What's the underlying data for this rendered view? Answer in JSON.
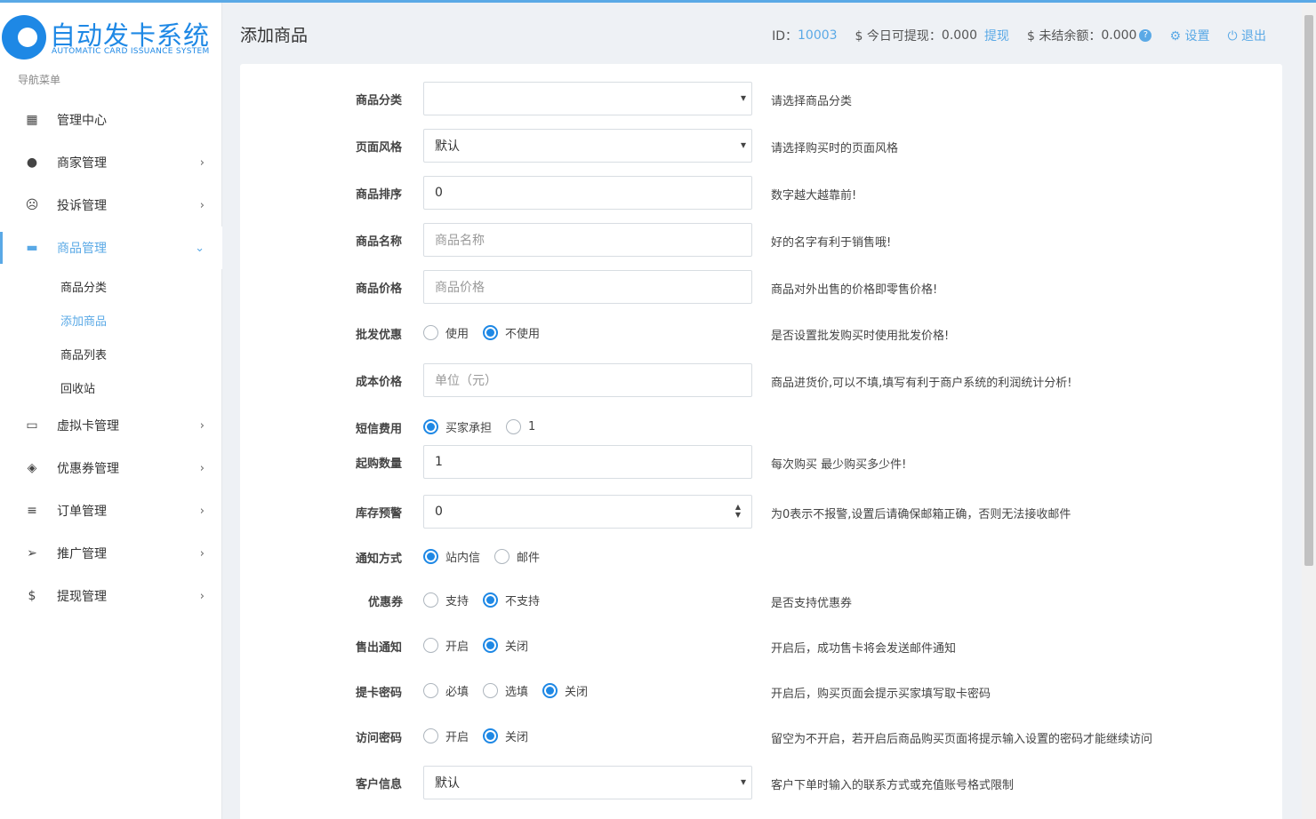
{
  "logo": {
    "title": "自动发卡系统",
    "subtitle": "AUTOMATIC CARD ISSUANCE SYSTEM"
  },
  "sidebar": {
    "caption": "导航菜单",
    "items": [
      {
        "label": "管理中心",
        "icon": "dashboard-icon",
        "glyph": "▦",
        "chev": ""
      },
      {
        "label": "商家管理",
        "icon": "user-icon",
        "glyph": "●",
        "chev": "›"
      },
      {
        "label": "投诉管理",
        "icon": "frown-icon",
        "glyph": "☹",
        "chev": "›"
      },
      {
        "label": "商品管理",
        "icon": "shopping-bag-icon",
        "glyph": "▬",
        "chev": "⌄"
      },
      {
        "label": "虚拟卡管理",
        "icon": "card-icon",
        "glyph": "▭",
        "chev": "›"
      },
      {
        "label": "优惠券管理",
        "icon": "ticket-icon",
        "glyph": "◈",
        "chev": "›"
      },
      {
        "label": "订单管理",
        "icon": "list-icon",
        "glyph": "≡",
        "chev": "›"
      },
      {
        "label": "推广管理",
        "icon": "paper-plane-icon",
        "glyph": "➢",
        "chev": "›"
      },
      {
        "label": "提现管理",
        "icon": "dollar-icon",
        "glyph": "$",
        "chev": "›"
      }
    ],
    "sub_items": [
      "商品分类",
      "添加商品",
      "商品列表",
      "回收站"
    ]
  },
  "header": {
    "page_title": "添加商品",
    "id_label": "ID：",
    "id_value": "10003",
    "withdrawable_label": "$ 今日可提现：",
    "withdrawable_value": "0.000",
    "withdraw_link": "提现",
    "unsettled_label": "$ 未结余额：",
    "unsettled_value": "0.000",
    "help_badge": "?",
    "settings_label": "设置",
    "logout_label": "退出"
  },
  "form": {
    "category": {
      "label": "商品分类",
      "value": "",
      "help": "请选择商品分类"
    },
    "page_style": {
      "label": "页面风格",
      "value": "默认",
      "help": "请选择购买时的页面风格"
    },
    "sort": {
      "label": "商品排序",
      "value": "0",
      "help": "数字越大越靠前!"
    },
    "name": {
      "label": "商品名称",
      "placeholder": "商品名称",
      "help": "好的名字有利于销售哦!"
    },
    "price": {
      "label": "商品价格",
      "placeholder": "商品价格",
      "help": "商品对外出售的价格即零售价格!"
    },
    "wholesale": {
      "label": "批发优惠",
      "options": [
        "使用",
        "不使用"
      ],
      "help": "是否设置批发购买时使用批发价格!"
    },
    "cost": {
      "label": "成本价格",
      "placeholder": "单位（元）",
      "help": "商品进货价,可以不填,填写有利于商户系统的利润统计分析!"
    },
    "sms_fee": {
      "label": "短信费用",
      "options": [
        "买家承担",
        "1"
      ]
    },
    "min_qty": {
      "label": "起购数量",
      "value": "1",
      "help": "每次购买 最少购买多少件!"
    },
    "stock_alert": {
      "label": "库存预警",
      "value": "0",
      "help": "为0表示不报警,设置后请确保邮箱正确，否则无法接收邮件"
    },
    "notify": {
      "label": "通知方式",
      "options": [
        "站内信",
        "邮件"
      ]
    },
    "coupon": {
      "label": "优惠券",
      "options": [
        "支持",
        "不支持"
      ],
      "help": "是否支持优惠券"
    },
    "sold_notify": {
      "label": "售出通知",
      "options": [
        "开启",
        "关闭"
      ],
      "help": "开启后，成功售卡将会发送邮件通知"
    },
    "card_password": {
      "label": "提卡密码",
      "options": [
        "必填",
        "选填",
        "关闭"
      ],
      "help": "开启后，购买页面会提示买家填写取卡密码"
    },
    "visit_password": {
      "label": "访问密码",
      "options": [
        "开启",
        "关闭"
      ],
      "help": "留空为不开启，若开启后商品购买页面将提示输入设置的密码才能继续访问"
    },
    "customer_info": {
      "label": "客户信息",
      "value": "默认",
      "help": "客户下单时输入的联系方式或充值账号格式限制"
    }
  }
}
